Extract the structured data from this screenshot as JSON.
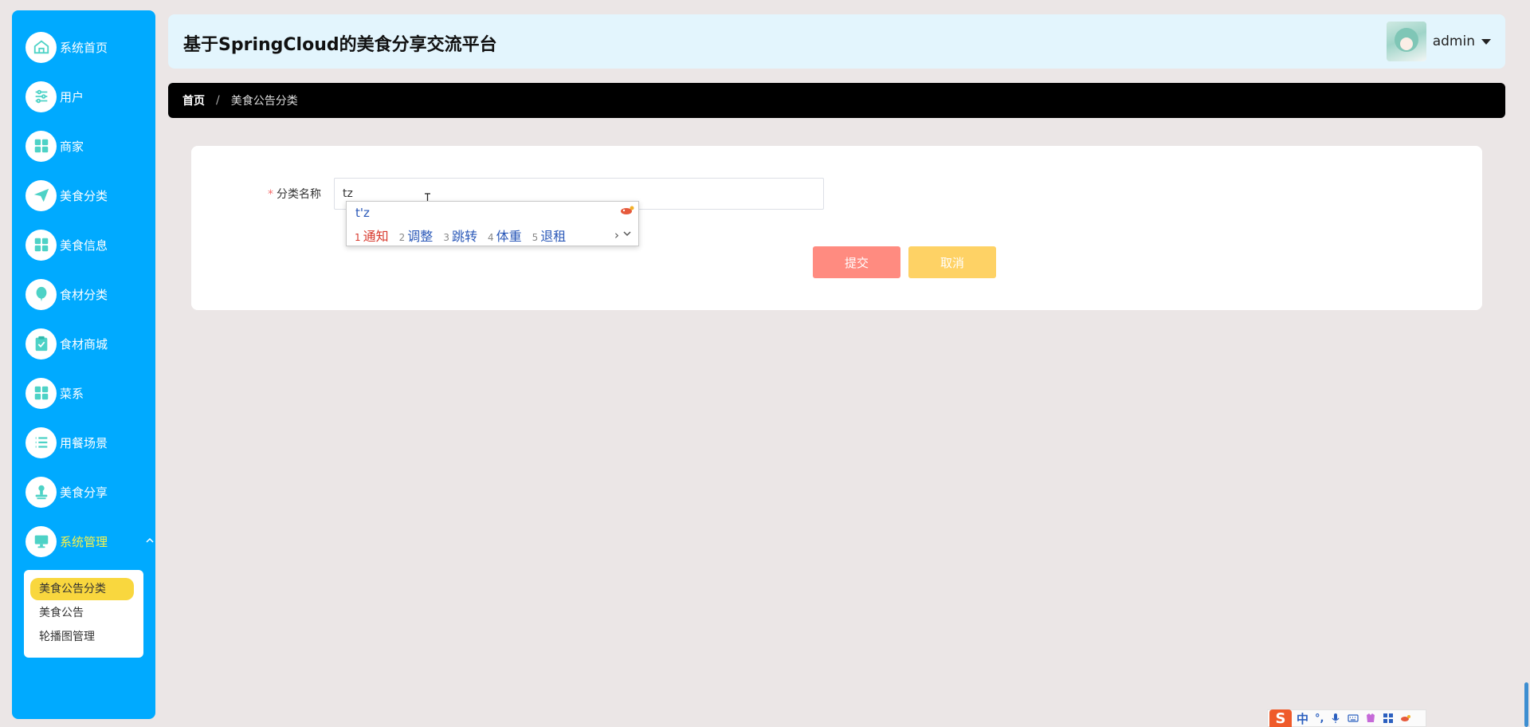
{
  "app": {
    "title": "基于SpringCloud的美食分享交流平台"
  },
  "user": {
    "name": "admin"
  },
  "sidebar": {
    "items": [
      {
        "label": "系统首页",
        "icon": "home-icon"
      },
      {
        "label": "用户",
        "icon": "sliders-icon"
      },
      {
        "label": "商家",
        "icon": "grid-icon"
      },
      {
        "label": "美食分类",
        "icon": "paper-plane-icon"
      },
      {
        "label": "美食信息",
        "icon": "grid-icon"
      },
      {
        "label": "食材分类",
        "icon": "balloon-icon"
      },
      {
        "label": "食材商城",
        "icon": "clipboard-check-icon"
      },
      {
        "label": "菜系",
        "icon": "grid-icon"
      },
      {
        "label": "用餐场景",
        "icon": "list-icon"
      },
      {
        "label": "美食分享",
        "icon": "stamp-icon"
      },
      {
        "label": "系统管理",
        "icon": "monitor-icon"
      }
    ],
    "submenu": [
      {
        "label": "美食公告分类",
        "active": true
      },
      {
        "label": "美食公告"
      },
      {
        "label": "轮播图管理"
      }
    ]
  },
  "breadcrumb": {
    "home": "首页",
    "separator": "/",
    "current": "美食公告分类"
  },
  "form": {
    "required_mark": "*",
    "name_label": "分类名称",
    "name_value": "tz",
    "submit_label": "提交",
    "cancel_label": "取消"
  },
  "ime": {
    "pinyin": "t'z",
    "candidates": [
      {
        "num": "1",
        "text": "通知"
      },
      {
        "num": "2",
        "text": "调整"
      },
      {
        "num": "3",
        "text": "跳转"
      },
      {
        "num": "4",
        "text": "体重"
      },
      {
        "num": "5",
        "text": "退租"
      }
    ],
    "more": "›"
  },
  "tray": {
    "logo": "S",
    "mode": "中",
    "punct": "°,"
  },
  "colors": {
    "sidebar": "#00aaff",
    "header": "#e3f5fd",
    "active_submenu": "#f9d73e",
    "submit": "#ff8b80",
    "cancel": "#fed265"
  }
}
